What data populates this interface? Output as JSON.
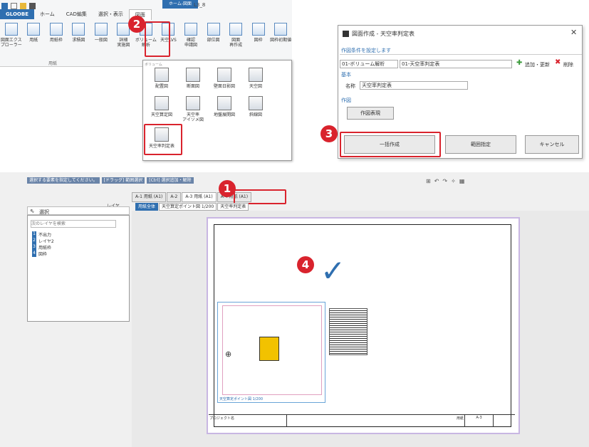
{
  "ribbon": {
    "context_tab": "ホーム-図面",
    "title_text": "L3_8",
    "tabs": [
      "GLOOBE",
      "ホーム",
      "CAD編集",
      "選択・表示",
      "図面"
    ],
    "commands": [
      {
        "label": "図面エクス\nプローラー"
      },
      {
        "label": "用紙"
      },
      {
        "label": "用紙枠"
      },
      {
        "label": "求積図"
      },
      {
        "label": "一般図"
      },
      {
        "label": "詳細\n実施図"
      },
      {
        "label": "ボリューム\n解析"
      },
      {
        "label": "天空LVS"
      },
      {
        "label": "確認\n申請図"
      },
      {
        "label": "部位図"
      },
      {
        "label": "図面\n再作成"
      },
      {
        "label": "図枠"
      },
      {
        "label": "図枠初期値"
      }
    ],
    "group_label": "用紙"
  },
  "dropdown": {
    "header": "ボリューム",
    "items": [
      {
        "label": "配置図"
      },
      {
        "label": "断面図"
      },
      {
        "label": "壁面日影図"
      },
      {
        "label": "天空図"
      },
      {
        "label": "天空算定図"
      },
      {
        "label": "天空率\nアイソメ図"
      },
      {
        "label": "地盤展開図"
      },
      {
        "label": "斜線図"
      },
      {
        "label": "天空率判定表"
      }
    ]
  },
  "dialog": {
    "title": "図面作成 - 天空率判定表",
    "subtitle": "作図条件を設定します",
    "select1": "01-ボリューム解析",
    "select2": "01-天空率判定表",
    "add_update": "追加・更新",
    "delete": "削除",
    "section_basic": "基本",
    "name_label": "名称",
    "name_value": "天空率判定表",
    "section_draw": "作図",
    "draw_display_button": "作図表現",
    "batch_button": "一括作成",
    "range_button": "範囲指定",
    "cancel_button": "キャンセル"
  },
  "app": {
    "status_hints": [
      "選択する要素を指定してください。",
      "[ドラッグ] 範囲選択",
      "[Ctrl] 選択追加・解除"
    ],
    "layer_button": "レイヤ",
    "panel_title": "選択",
    "search_placeholder": "次のレイヤを検索",
    "layers": [
      {
        "num": "1",
        "name": "不出力"
      },
      {
        "num": "2",
        "name": "レイヤ2"
      },
      {
        "num": "3",
        "name": "用紙枠"
      },
      {
        "num": "4",
        "name": "図枠"
      }
    ],
    "doc_tabs": [
      "A-1 用紙 (A1)",
      "A-2",
      "A-3 用紙 (A1)",
      "A-4 用紙 (A1)"
    ],
    "sub_tabs": [
      "用紙全体",
      "天空算定ポイント図 1/200",
      "天空率判定表"
    ],
    "viewport_caption": "天空算定ポイント図 1/200",
    "titleblock": {
      "project": "プロジェクト名",
      "sheet": "用紙",
      "number": "A-3"
    }
  },
  "badges": [
    "1",
    "2",
    "3",
    "4"
  ]
}
